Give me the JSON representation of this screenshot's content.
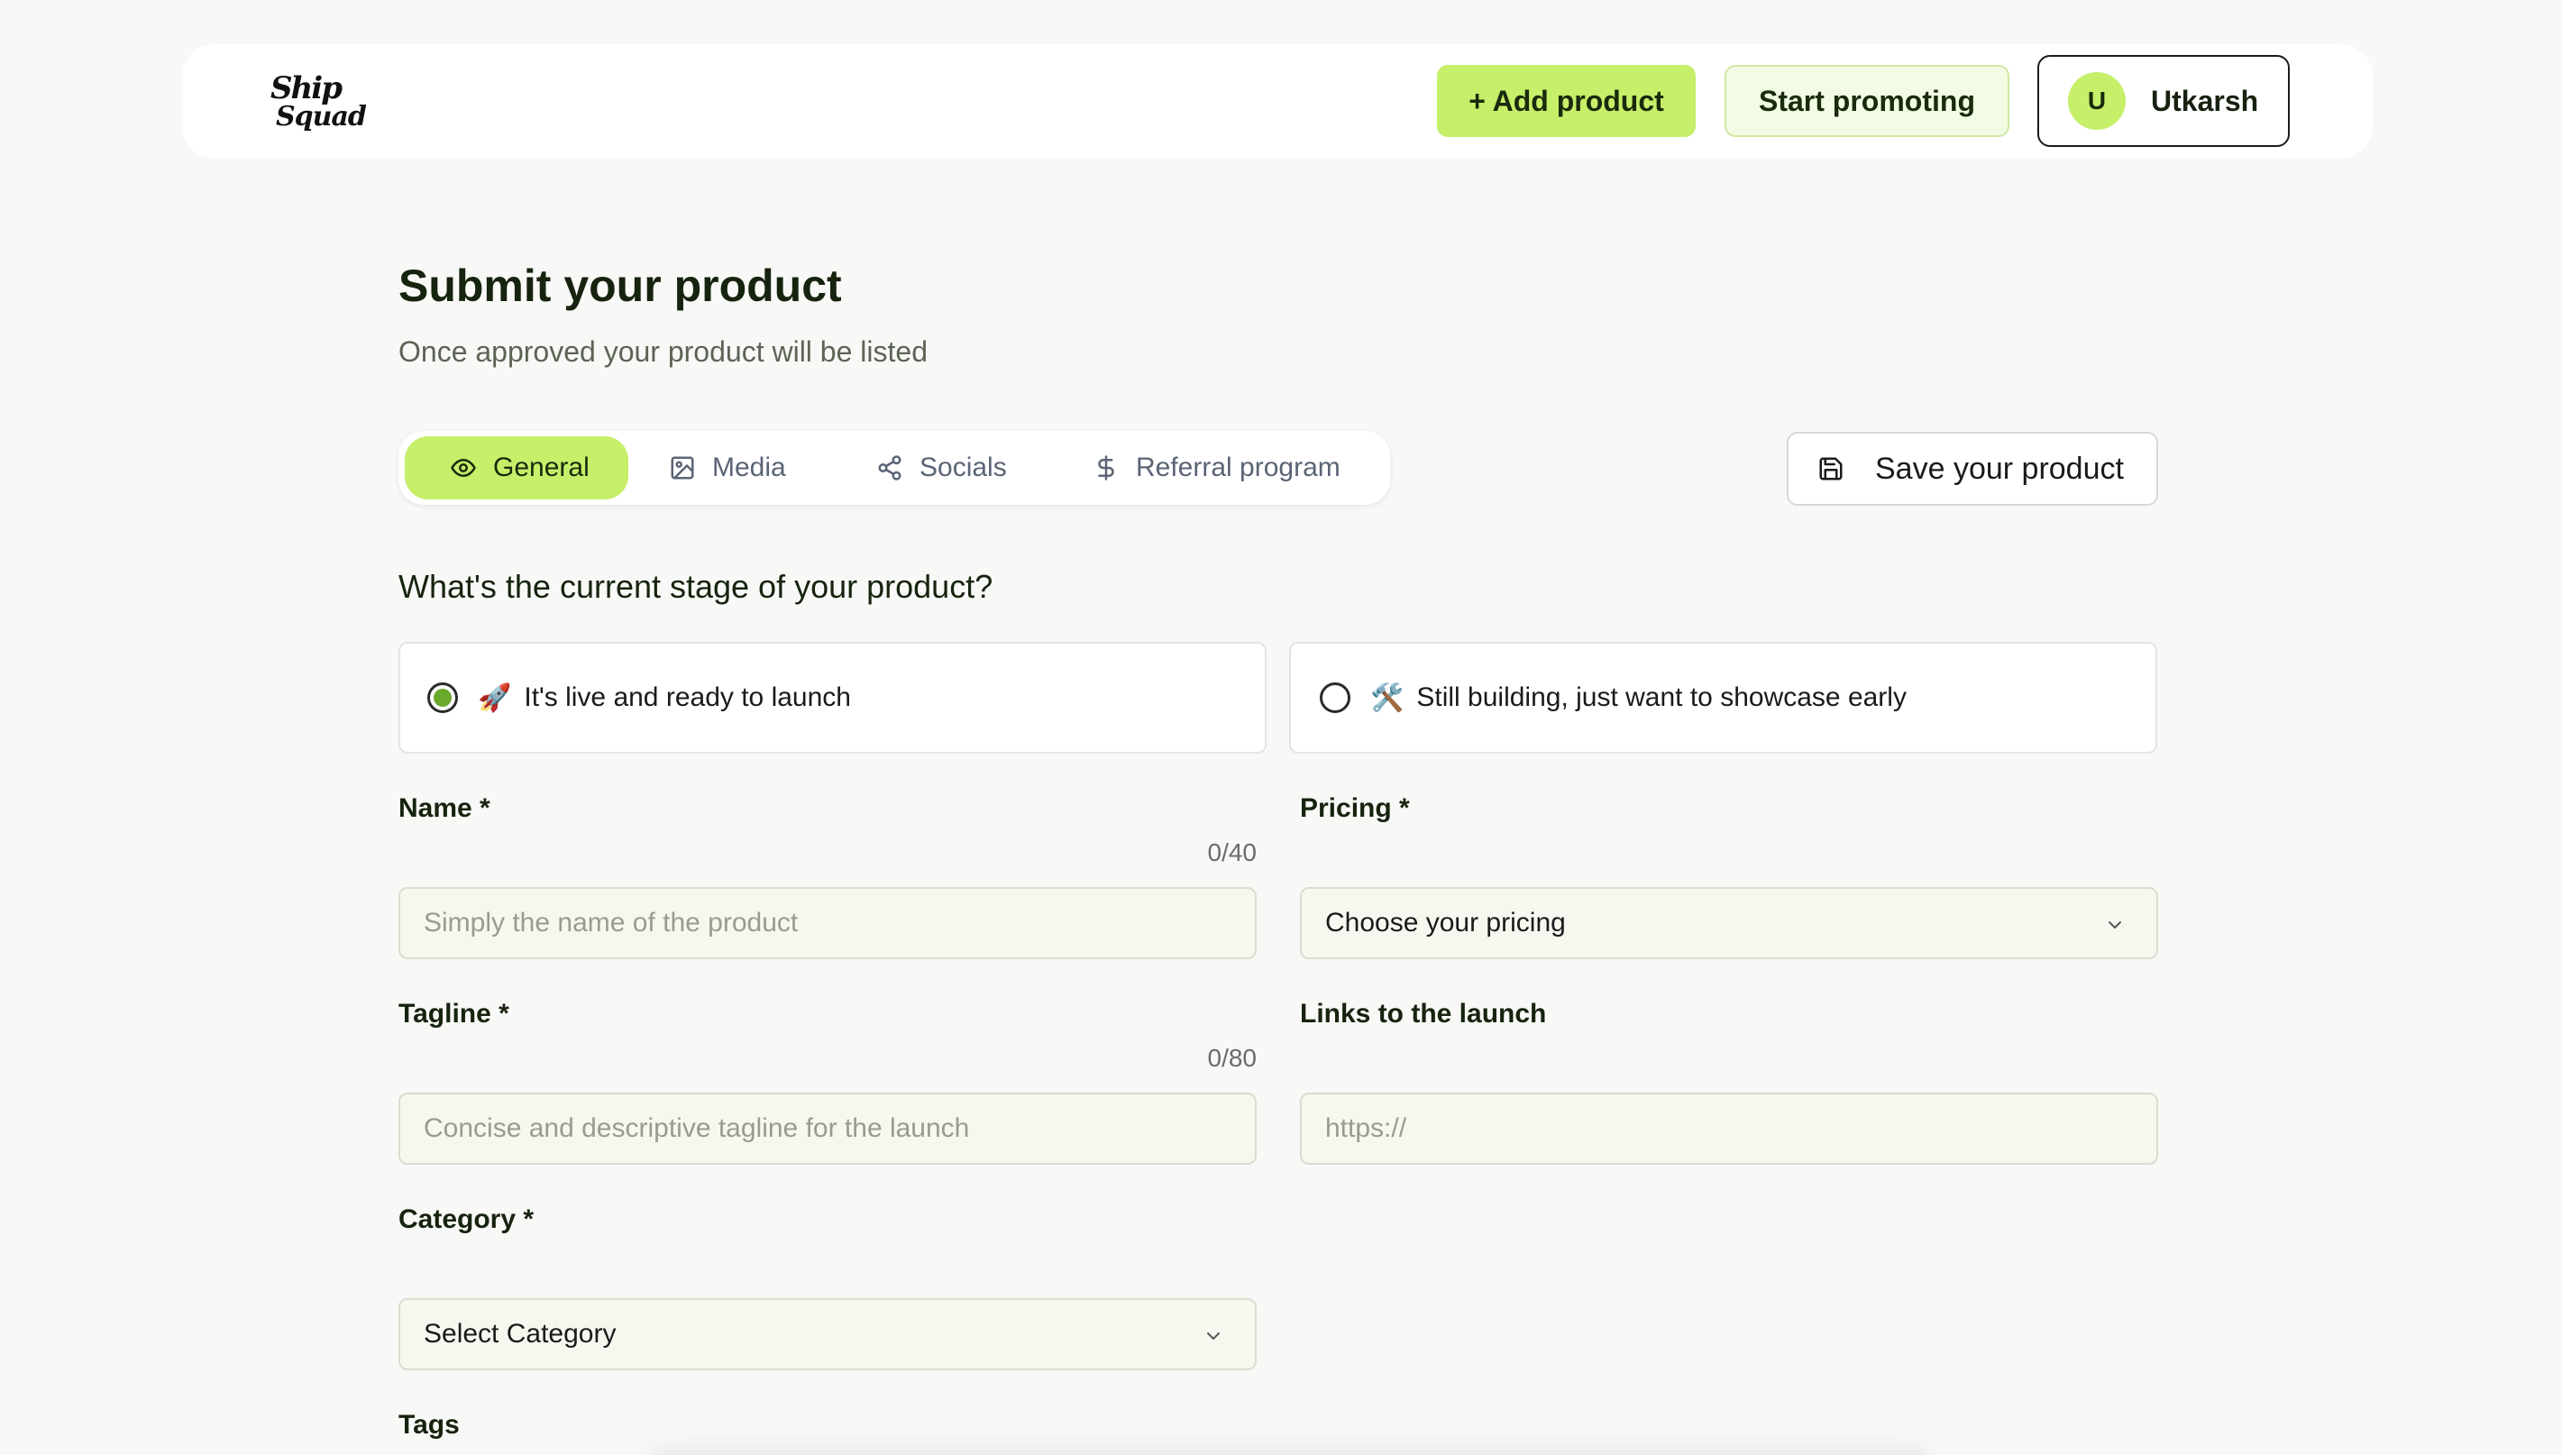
{
  "header": {
    "logo_line1": "Ship",
    "logo_line2": "Squad",
    "add_product": "+ Add product",
    "start_promoting": "Start promoting",
    "user_initial": "U",
    "user_name": "Utkarsh"
  },
  "page": {
    "title": "Submit your product",
    "subtitle": "Once approved your product will be listed"
  },
  "tabs": [
    {
      "label": "General",
      "icon": "eye-icon",
      "active": true
    },
    {
      "label": "Media",
      "icon": "image-icon",
      "active": false
    },
    {
      "label": "Socials",
      "icon": "share-icon",
      "active": false
    },
    {
      "label": "Referral program",
      "icon": "dollar-icon",
      "active": false
    }
  ],
  "save_button": "Save your product",
  "stage": {
    "question": "What's the current stage of your product?",
    "options": [
      {
        "emoji": "🚀",
        "label": "It's live and ready to launch",
        "selected": true
      },
      {
        "emoji": "🛠️",
        "label": "Still building, just want to showcase early",
        "selected": false
      }
    ]
  },
  "form": {
    "name": {
      "label": "Name *",
      "counter": "0/40",
      "placeholder": "Simply the name of the product"
    },
    "pricing": {
      "label": "Pricing *",
      "value": "Choose your pricing"
    },
    "tagline": {
      "label": "Tagline *",
      "counter": "0/80",
      "placeholder": "Concise and descriptive tagline for the launch"
    },
    "links": {
      "label": "Links to the launch",
      "placeholder": "https://"
    },
    "category": {
      "label": "Category *",
      "value": "Select Category"
    },
    "tags": {
      "label": "Tags"
    }
  },
  "colors": {
    "accent": "#c6ef6a",
    "accent_light": "#f2fbe4",
    "field_bg": "#f5f8ef",
    "radio_selected": "#6aa92a"
  }
}
